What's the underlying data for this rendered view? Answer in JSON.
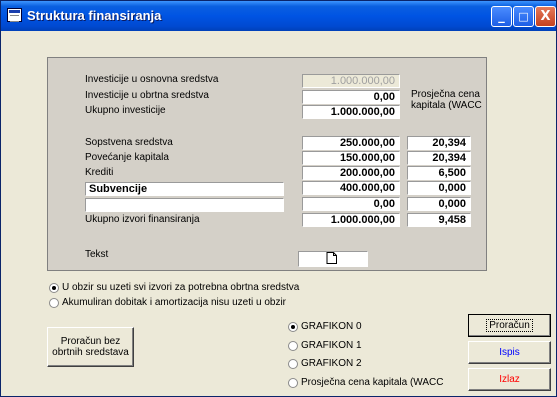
{
  "window": {
    "title": "Struktura finansiranja"
  },
  "titlebar": {
    "minimize": "_",
    "maximize": "□",
    "close": "X"
  },
  "investments": {
    "fixed_label": "Investicije u osnovna sredstva",
    "fixed_value": "1.000.000,00",
    "working_label": "Investicije u obrtna sredstva",
    "working_value": "0,00",
    "total_label": "Ukupno investicije",
    "total_value": "1.000.000,00"
  },
  "wacc_label": "Prosječna cena kapitala (WACC",
  "sources": [
    {
      "label": "Sopstvena sredstva",
      "amount": "250.000,00",
      "rate": "20,394"
    },
    {
      "label": "Povećanje kapitala",
      "amount": "150.000,00",
      "rate": "20,394"
    },
    {
      "label": "Krediti",
      "amount": "200.000,00",
      "rate": "6,500"
    },
    {
      "label": "Subvencije",
      "amount": "400.000,00",
      "rate": "0,000"
    },
    {
      "label": "",
      "amount": "0,00",
      "rate": "0,000"
    }
  ],
  "total_sources": {
    "label": "Ukupno izvori finansiranja",
    "amount": "1.000.000,00",
    "rate": "9,458"
  },
  "tekst_label": "Tekst",
  "options": {
    "opt1": "U obzir su uzeti svi izvori za potrebna obrtna sredstva",
    "opt2": "Akumuliran dobitak i amortizacija nisu uzeti u obzir"
  },
  "calc_without_button": "Proračun bez obrtnih sredstava",
  "charts": [
    "GRAFIKON 0",
    "GRAFIKON 1",
    "GRAFIKON 2",
    "Prosječna cena kapitala (WACC"
  ],
  "buttons": {
    "calc": "Proračun",
    "print": "Ispis",
    "exit": "Izlaz"
  },
  "colors": {
    "print": "#0000ff",
    "exit": "#ff0000"
  }
}
